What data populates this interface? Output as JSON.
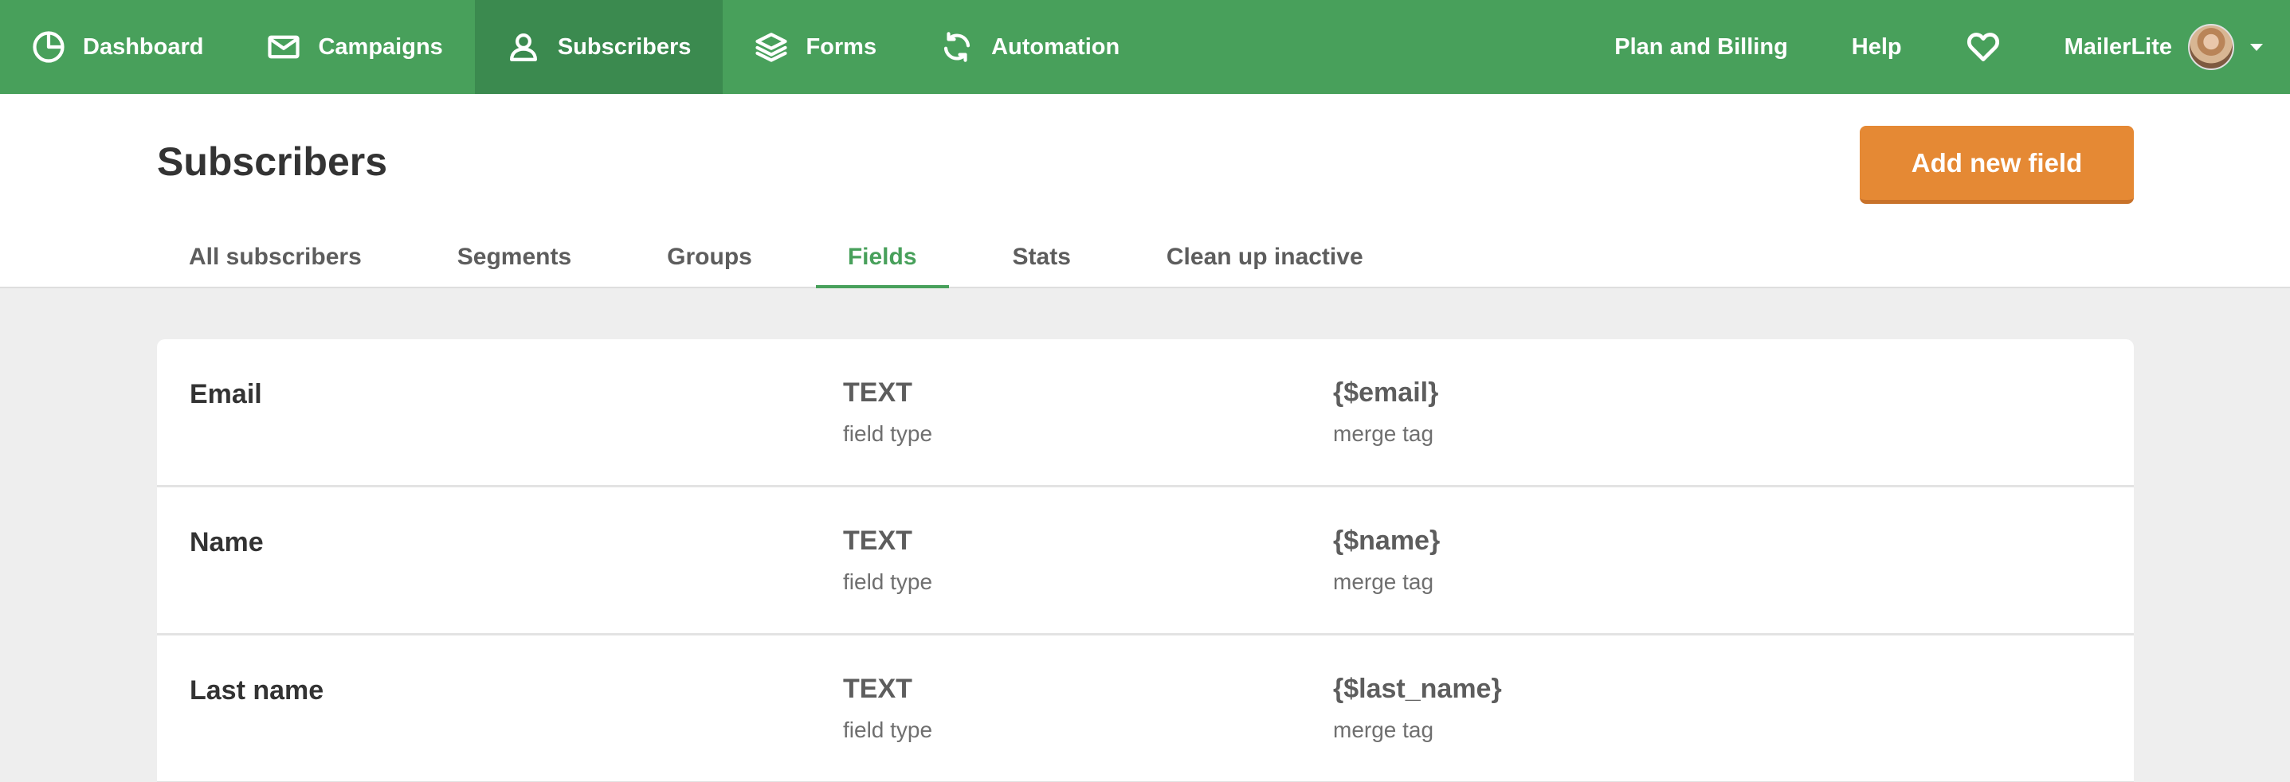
{
  "nav": {
    "items": [
      {
        "label": "Dashboard",
        "icon": "pie-chart-icon"
      },
      {
        "label": "Campaigns",
        "icon": "envelope-icon"
      },
      {
        "label": "Subscribers",
        "icon": "user-icon",
        "active": true
      },
      {
        "label": "Forms",
        "icon": "layers-icon"
      },
      {
        "label": "Automation",
        "icon": "refresh-icon"
      }
    ],
    "plan_billing": "Plan and Billing",
    "help": "Help",
    "favorites_icon": "heart-icon",
    "account_name": "MailerLite"
  },
  "page": {
    "title": "Subscribers",
    "add_button": "Add new field"
  },
  "tabs": [
    {
      "label": "All subscribers"
    },
    {
      "label": "Segments"
    },
    {
      "label": "Groups"
    },
    {
      "label": "Fields",
      "active": true
    },
    {
      "label": "Stats"
    },
    {
      "label": "Clean up inactive"
    }
  ],
  "fields": [
    {
      "name": "Email",
      "type": "TEXT",
      "type_caption": "field type",
      "merge_tag": "{$email}",
      "tag_caption": "merge tag"
    },
    {
      "name": "Name",
      "type": "TEXT",
      "type_caption": "field type",
      "merge_tag": "{$name}",
      "tag_caption": "merge tag"
    },
    {
      "name": "Last name",
      "type": "TEXT",
      "type_caption": "field type",
      "merge_tag": "{$last_name}",
      "tag_caption": "merge tag"
    }
  ],
  "colors": {
    "brand_green": "#48a05b",
    "active_nav": "#3b8a4f",
    "accent_orange": "#e58934"
  }
}
